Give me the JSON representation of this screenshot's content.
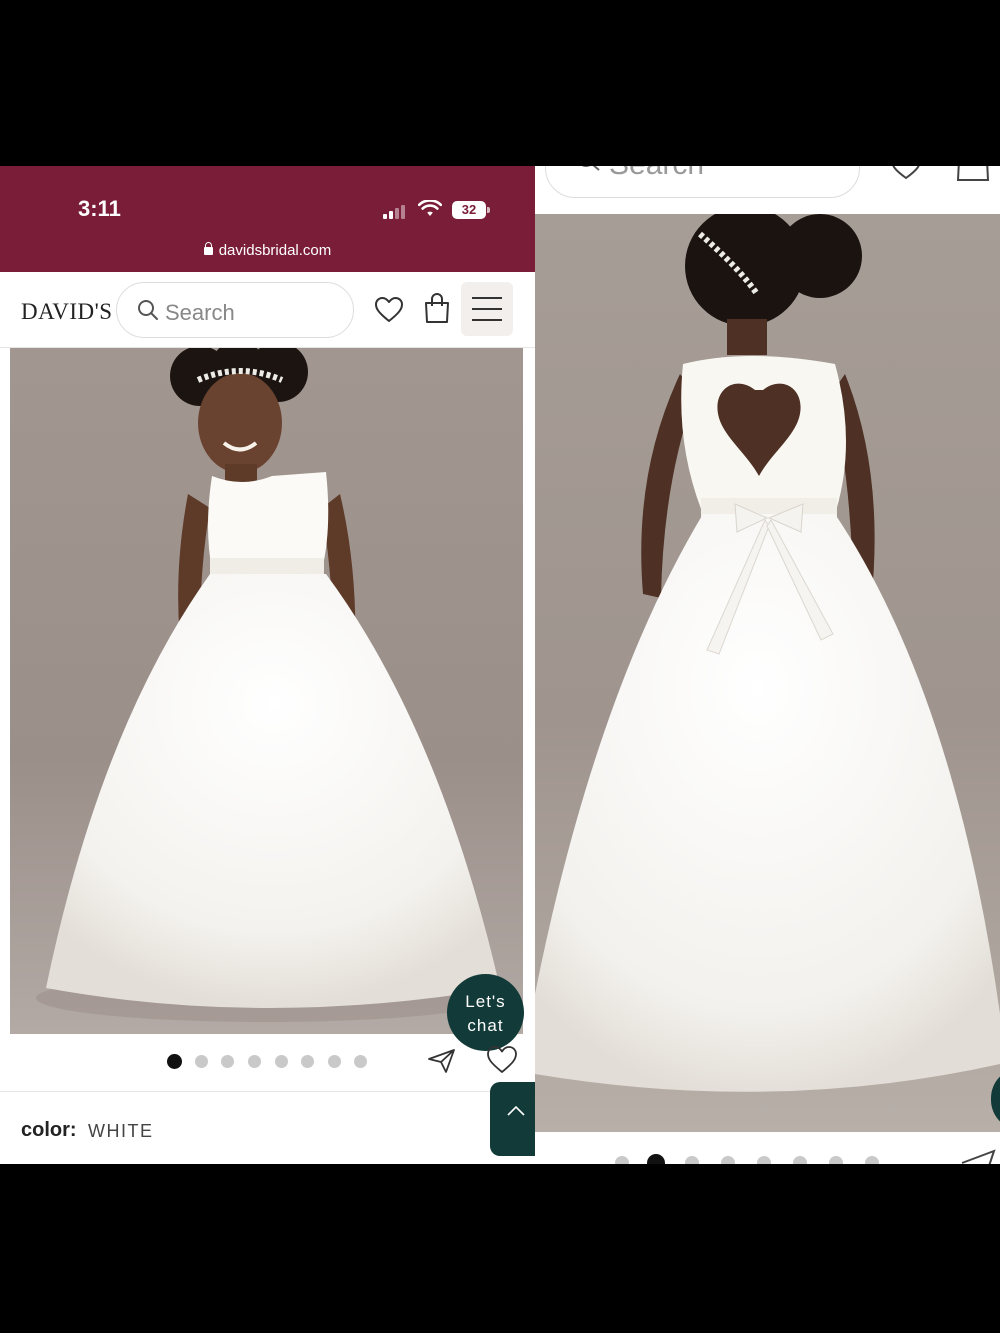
{
  "colors": {
    "status_bar": "#7a1d38",
    "chat_button": "#123a38",
    "photo_background": "#a1958f"
  },
  "left": {
    "status_bar": {
      "time": "3:11",
      "battery": "32",
      "url": "davidsbridal.com"
    },
    "header": {
      "logo": "DAVID'S",
      "search_placeholder": "Search",
      "icons": [
        "heart-icon",
        "shopping-bag-icon",
        "hamburger-menu-icon"
      ]
    },
    "gallery": {
      "image_count": 8,
      "active_index": 0
    },
    "chat_label_line1": "Let's",
    "chat_label_line2": "chat",
    "color_label": "color:",
    "color_value": "WHITE"
  },
  "right": {
    "search_placeholder": "Search",
    "gallery": {
      "image_count": 8,
      "active_index": 1
    }
  }
}
